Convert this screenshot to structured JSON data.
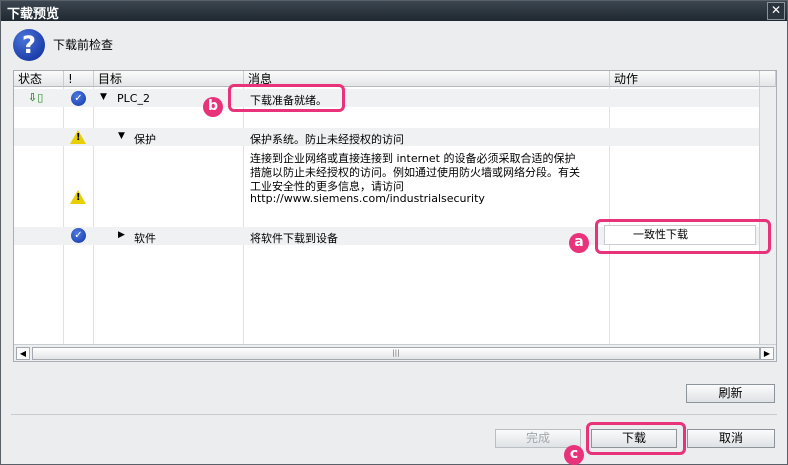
{
  "window": {
    "title": "下载预览",
    "close_label": "✕"
  },
  "header": {
    "title": "下载前检查",
    "icon": "question-icon"
  },
  "grid": {
    "columns": [
      "状态",
      "!",
      "目标",
      "消息",
      "动作"
    ],
    "rows": [
      {
        "target": "PLC_2",
        "message": "下载准备就绪。",
        "action": ""
      },
      {
        "target": "保护",
        "message": "保护系统。防止未经授权的访问",
        "action": ""
      },
      {
        "target": "",
        "message_lines": [
          "连接到企业网络或直接连接到 internet 的设备必须采取合适的保护",
          "措施以防止未经授权的访问。例如通过使用防火墙或网络分段。有关",
          "工业安全性的更多信息，请访问",
          "http://www.siemens.com/industrialsecurity"
        ],
        "action": ""
      },
      {
        "target": "软件",
        "message": "将软件下载到设备",
        "action": "一致性下载"
      }
    ],
    "scroll_thumb_glyph": "|||"
  },
  "buttons": {
    "refresh": "刷新",
    "finish": "完成",
    "download": "下载",
    "cancel": "取消"
  },
  "annotations": {
    "a": "a",
    "b": "b",
    "c": "c"
  },
  "colors": {
    "callout": "#e8327a",
    "accent": "#1138a8",
    "warning": "#e8d000"
  }
}
